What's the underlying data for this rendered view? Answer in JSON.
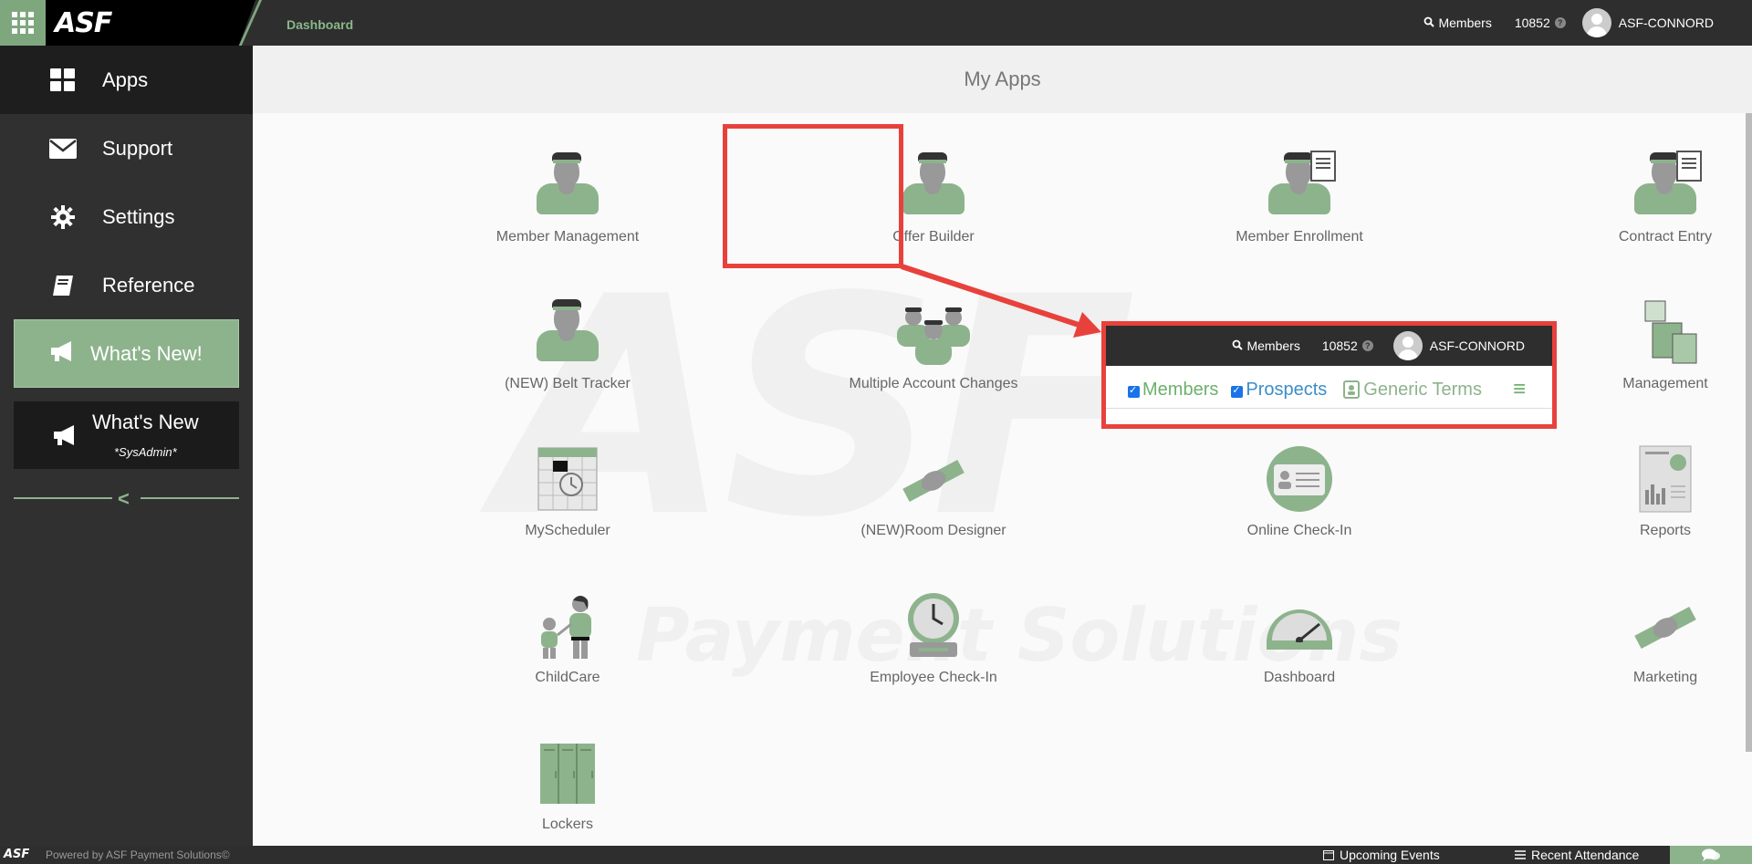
{
  "topbar": {
    "logo": "ASF",
    "breadcrumb": "Dashboard",
    "search_label": "Members",
    "count": "10852",
    "help": "?",
    "user": "ASF-CONNORD"
  },
  "sidebar": {
    "items": [
      {
        "label": "Apps",
        "icon": "apps-grid-icon"
      },
      {
        "label": "Support",
        "icon": "envelope-icon"
      },
      {
        "label": "Settings",
        "icon": "gear-icon"
      },
      {
        "label": "Reference",
        "icon": "book-icon"
      }
    ],
    "whats_new": "What's New!",
    "whats_new_admin": "What's New",
    "whats_new_admin_sub": "*SysAdmin*",
    "collapse": "<"
  },
  "main": {
    "title": "My Apps",
    "apps": [
      {
        "label": "Member Management"
      },
      {
        "label": "Offer Builder"
      },
      {
        "label": "Member Enrollment"
      },
      {
        "label": "Contract Entry"
      },
      {
        "label": "(NEW) Belt Tracker"
      },
      {
        "label": "Multiple Account Changes"
      },
      {
        "label": "Management"
      },
      {
        "label": "MyScheduler"
      },
      {
        "label": "(NEW)Room Designer"
      },
      {
        "label": "Online Check-In"
      },
      {
        "label": "Reports"
      },
      {
        "label": "ChildCare"
      },
      {
        "label": "Employee Check-In"
      },
      {
        "label": "Dashboard"
      },
      {
        "label": "Marketing"
      },
      {
        "label": "Lockers"
      }
    ]
  },
  "popup": {
    "search_label": "Members",
    "count": "10852",
    "user": "ASF-CONNORD",
    "tab_members": "Members",
    "tab_prospects": "Prospects",
    "tab_generic": "Generic Terms",
    "menu": "≡"
  },
  "footer": {
    "logo": "ASF",
    "powered": "Powered by ASF Payment Solutions©",
    "events": "Upcoming Events",
    "attendance": "Recent Attendance"
  },
  "colors": {
    "accent": "#8db38c",
    "highlight": "#e8413c",
    "bar": "#2e2e2e"
  }
}
